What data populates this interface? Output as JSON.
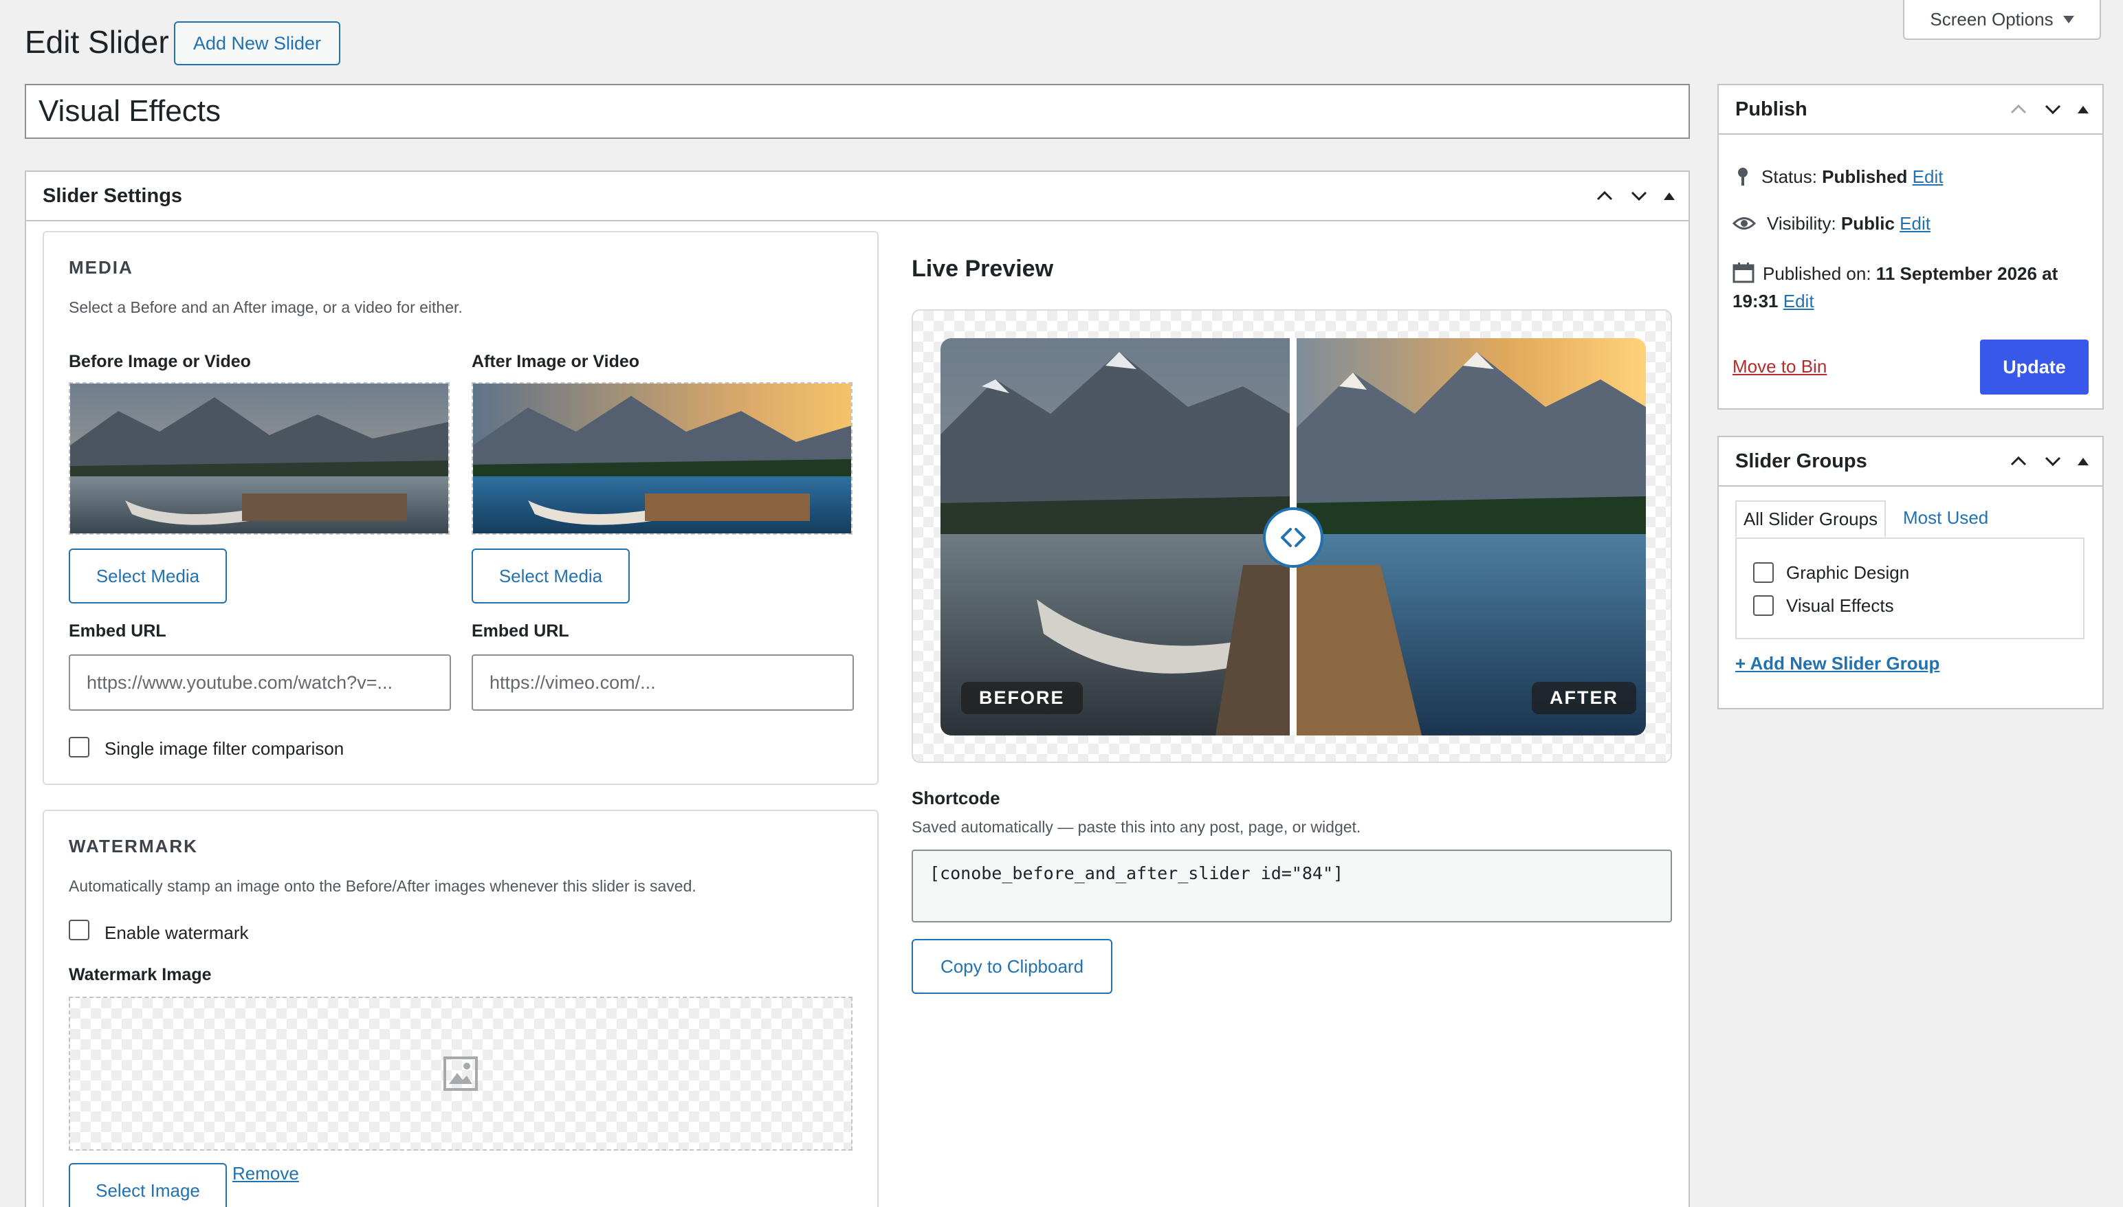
{
  "header": {
    "page_title": "Edit Slider",
    "add_new_label": "Add New Slider",
    "screen_options_label": "Screen Options"
  },
  "title_input": {
    "value": "Visual Effects"
  },
  "slider_settings": {
    "heading": "Slider Settings",
    "media": {
      "title": "MEDIA",
      "description": "Select a Before and an After image, or a video for either.",
      "before_label": "Before Image or Video",
      "after_label": "After Image or Video",
      "select_media_label": "Select Media",
      "embed_url_label": "Embed URL",
      "before_embed_placeholder": "https://www.youtube.com/watch?v=...",
      "after_embed_placeholder": "https://vimeo.com/...",
      "single_filter_label": "Single image filter comparison"
    },
    "watermark": {
      "title": "WATERMARK",
      "description": "Automatically stamp an image onto the Before/After images whenever this slider is saved.",
      "enable_label": "Enable watermark",
      "image_label": "Watermark Image",
      "select_image_label": "Select Image",
      "remove_label": "Remove"
    },
    "preview": {
      "title": "Live Preview",
      "before_badge": "BEFORE",
      "after_badge": "AFTER",
      "handle_icon": "code-arrows-icon"
    },
    "shortcode": {
      "label": "Shortcode",
      "description": "Saved automatically — paste this into any post, page, or widget.",
      "value": "[conobe_before_and_after_slider id=\"84\"]",
      "copy_label": "Copy to Clipboard"
    }
  },
  "publish": {
    "heading": "Publish",
    "status_label": "Status:",
    "status_value": "Published",
    "visibility_label": "Visibility:",
    "visibility_value": "Public",
    "published_label": "Published on:",
    "published_value": "11 September 2026 at",
    "published_time": "19:31",
    "edit_label": "Edit",
    "move_to_bin_label": "Move to Bin",
    "update_label": "Update"
  },
  "slider_groups": {
    "heading": "Slider Groups",
    "tab_all": "All Slider Groups",
    "tab_most_used": "Most Used",
    "groups": [
      "Graphic Design",
      "Visual Effects"
    ],
    "add_new_label": "+ Add New Slider Group"
  },
  "colors": {
    "accent": "#2271b1",
    "primary_button": "#3858e9",
    "danger": "#b32d2e",
    "background": "#f0f0f1"
  }
}
